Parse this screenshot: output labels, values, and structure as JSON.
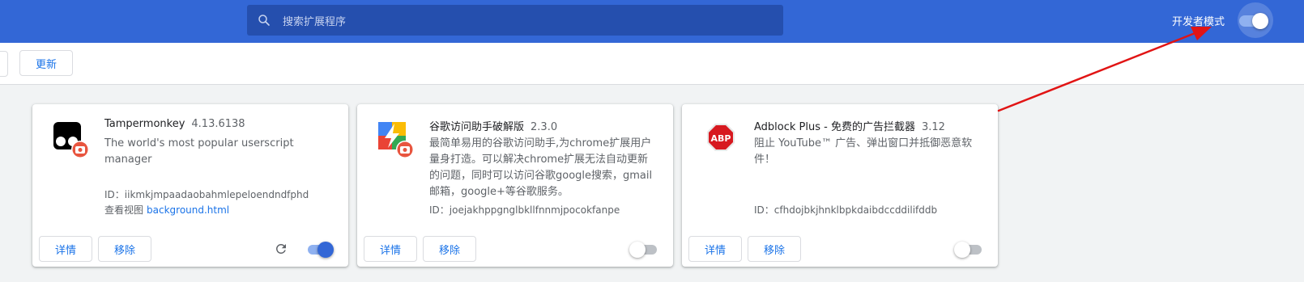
{
  "header": {
    "search_placeholder": "搜索扩展程序",
    "dev_mode_label": "开发者模式",
    "dev_mode_enabled": true,
    "background_color": "#3367d6"
  },
  "toolbar": {
    "update_label": "更新"
  },
  "extensions": [
    {
      "name": "Tampermonkey",
      "version": "4.13.6138",
      "description": "The world's most popular userscript manager",
      "id_text": "ID：iikmkjmpaadaobahmlepeloendndfphd",
      "views_label": "查看视图",
      "views_link": "background.html",
      "details_label": "详情",
      "remove_label": "移除",
      "enabled": true,
      "icon": "tampermonkey-icon"
    },
    {
      "name": "谷歌访问助手破解版",
      "version": "2.3.0",
      "description": "最简单易用的谷歌访问助手,为chrome扩展用户量身打造。可以解决chrome扩展无法自动更新的问题，同时可以访问谷歌google搜索，gmail邮箱，google+等谷歌服务。",
      "id_text": "ID：joejakhppgnglbkllfnnmjpocokfanpe",
      "details_label": "详情",
      "remove_label": "移除",
      "enabled": false,
      "icon": "google-helper-icon"
    },
    {
      "name": "Adblock Plus - 免费的广告拦截器",
      "version": "3.12",
      "description": "阻止 YouTube™ 广告、弹出窗口并抵御恶意软件！",
      "id_text": "ID：cfhdojbkjhnklbpkdaibdccddilifddb",
      "details_label": "详情",
      "remove_label": "移除",
      "enabled": false,
      "icon": "adblock-plus-icon",
      "icon_text": "ABP"
    }
  ],
  "colors": {
    "accent": "#1a73e8",
    "annotation_arrow": "#e11414"
  }
}
